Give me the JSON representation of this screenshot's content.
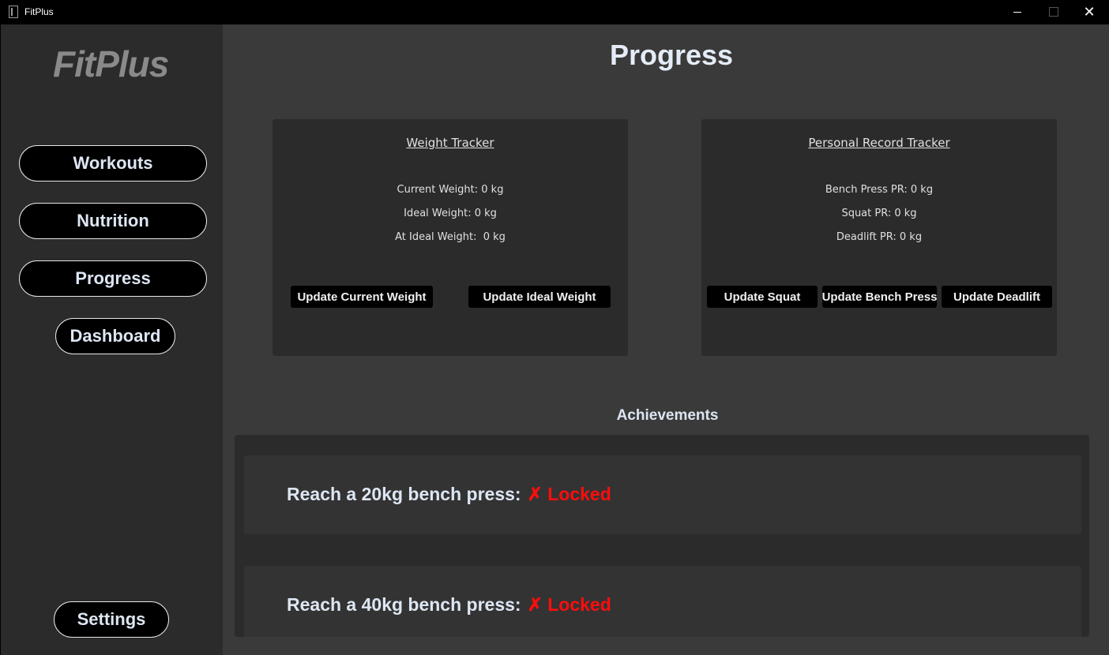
{
  "window": {
    "title": "FitPlus",
    "close_glyph": "✕"
  },
  "sidebar": {
    "logo": "FitPlus",
    "nav": {
      "workouts": "Workouts",
      "nutrition": "Nutrition",
      "progress": "Progress",
      "dashboard": "Dashboard"
    },
    "settings": "Settings"
  },
  "main": {
    "title": "Progress",
    "weight_tracker": {
      "title": "Weight Tracker",
      "current": "Current Weight: 0 kg",
      "ideal": "Ideal Weight: 0 kg",
      "at_ideal": "At Ideal Weight:  0 kg",
      "update_current": "Update Current Weight",
      "update_ideal": "Update Ideal Weight"
    },
    "pr_tracker": {
      "title": "Personal Record Tracker",
      "bench": "Bench Press PR: 0 kg",
      "squat": "Squat PR: 0 kg",
      "deadlift": "Deadlift PR: 0 kg",
      "update_squat": "Update Squat",
      "update_bench": "Update Bench Press",
      "update_deadlift": "Update Deadlift"
    },
    "achievements": {
      "title": "Achievements",
      "items": [
        {
          "label": "Reach a 20kg bench press:",
          "status": "✗ Locked"
        },
        {
          "label": "Reach a 40kg bench press:",
          "status": "✗ Locked"
        }
      ]
    }
  },
  "colors": {
    "sidebar_bg": "#2b2b2b",
    "main_bg": "#3a3a3a",
    "locked": "#ff0d0d",
    "accent_text": "#dde6f2"
  }
}
